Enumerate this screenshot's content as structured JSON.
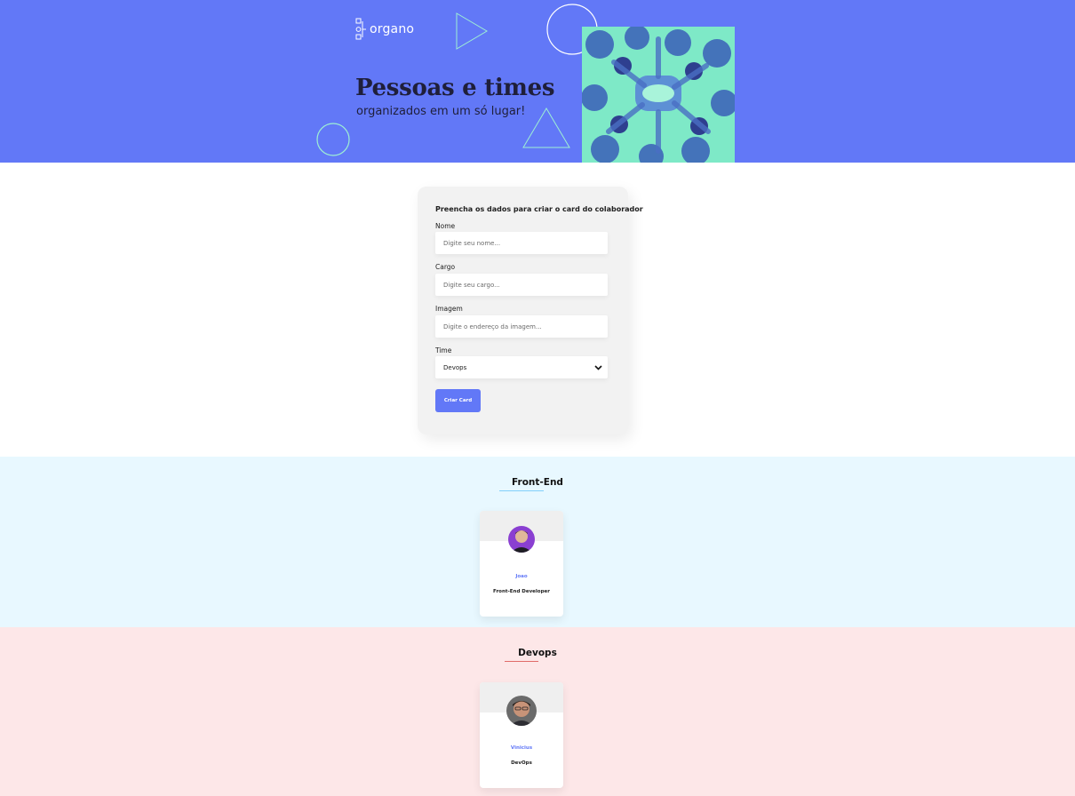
{
  "banner": {
    "logo_text": "organo",
    "headline": "Pessoas e times",
    "subline": "organizados em um só lugar!",
    "background": "#6278F7",
    "photo_description_icon": "team-hands-photo"
  },
  "form": {
    "title": "Preencha os dados para criar o card do colaborador",
    "fields": [
      {
        "label": "Nome",
        "placeholder": "Digite seu nome..."
      },
      {
        "label": "Cargo",
        "placeholder": "Digite seu cargo..."
      },
      {
        "label": "Imagem",
        "placeholder": "Digite o endereço da imagem..."
      }
    ],
    "select": {
      "label": "Time",
      "value": "Devops"
    },
    "submit_label": "Criar Card",
    "accent": "#6278F7"
  },
  "teams": [
    {
      "name": "Front-End",
      "primary_color": "#82CFFA",
      "background": "#E8F8FF",
      "members": [
        {
          "name": "Joao",
          "role": "Front-End Developer"
        }
      ]
    },
    {
      "name": "Devops",
      "primary_color": "#E06B69",
      "background": "#FDE7E8",
      "members": [
        {
          "name": "Vinicius",
          "role": "DevOps"
        }
      ]
    }
  ]
}
